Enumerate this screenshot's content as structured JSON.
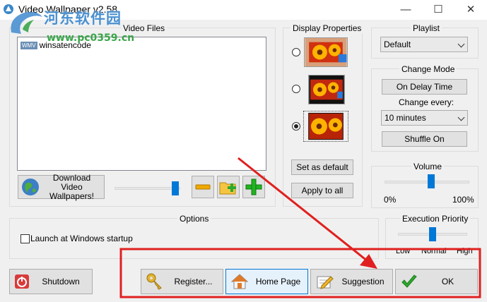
{
  "window": {
    "title": "Video Wallpaper  v2.58"
  },
  "watermark": {
    "site_cn": "河东软件园",
    "url": "www.pc0359.cn"
  },
  "video_files": {
    "label": "Video Files",
    "items": [
      {
        "icon_text": "WMV",
        "name": "winsatencode"
      }
    ],
    "download_label": "Download Video Wallpapers!",
    "slider_level": 0.97
  },
  "display_properties": {
    "label": "Display Properties",
    "modes": [
      {
        "selected": false
      },
      {
        "selected": false
      },
      {
        "selected": true
      }
    ],
    "set_default_label": "Set as default",
    "apply_all_label": "Apply to all"
  },
  "playlist": {
    "label": "Playlist",
    "value": "Default"
  },
  "change_mode": {
    "label": "Change Mode",
    "mode_button": "On Delay Time",
    "every_label": "Change every:",
    "every_value": "10 minutes",
    "shuffle_label": "Shuffle On"
  },
  "volume": {
    "label": "Volume",
    "min": "0%",
    "max": "100%",
    "level": 0.55
  },
  "options": {
    "label": "Options",
    "launch_label": "Launch at Windows startup",
    "launch_checked": false
  },
  "execution_priority": {
    "label": "Execution Priority",
    "ticks": [
      "Low",
      "Normal",
      "High"
    ],
    "selected": "Normal"
  },
  "footer": {
    "shutdown": "Shutdown",
    "register": "Register...",
    "homepage": "Home Page",
    "suggestion": "Suggestion",
    "ok": "OK"
  },
  "colors": {
    "accent": "#0078d7",
    "annotation": "#e02020",
    "watermark_blue": "#4a90d0",
    "watermark_green": "#3aa54a"
  }
}
